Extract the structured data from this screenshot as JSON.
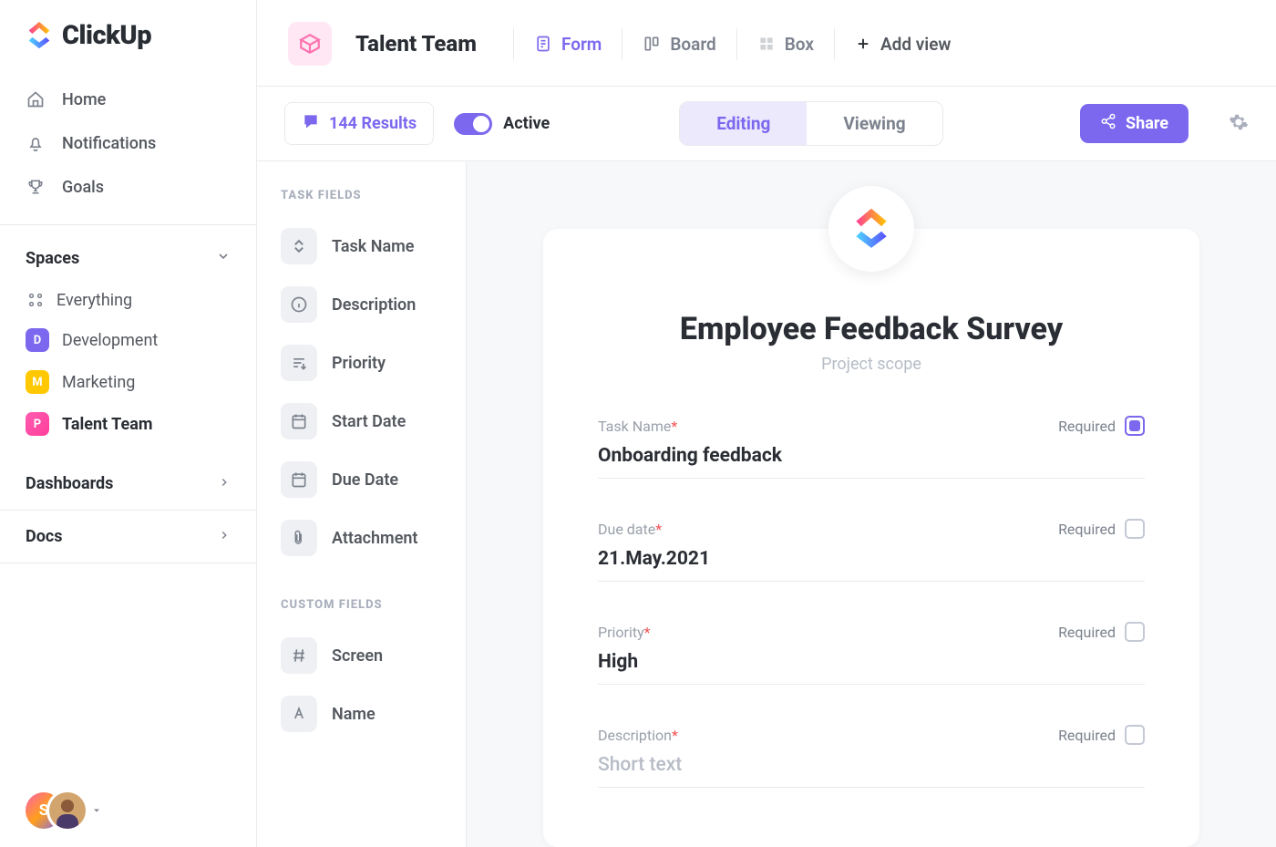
{
  "brand": {
    "name": "ClickUp"
  },
  "sidebar": {
    "nav": [
      {
        "label": "Home"
      },
      {
        "label": "Notifications"
      },
      {
        "label": "Goals"
      }
    ],
    "spaces_heading": "Spaces",
    "everything": "Everything",
    "spaces": [
      {
        "letter": "D",
        "label": "Development"
      },
      {
        "letter": "M",
        "label": "Marketing"
      },
      {
        "letter": "P",
        "label": "Talent Team"
      }
    ],
    "dashboards": "Dashboards",
    "docs": "Docs",
    "user_initial": "S"
  },
  "topbar": {
    "space_title": "Talent Team",
    "tabs": {
      "form": "Form",
      "board": "Board",
      "box": "Box",
      "add": "Add view"
    }
  },
  "toolbar": {
    "results": "144 Results",
    "active": "Active",
    "editing": "Editing",
    "viewing": "Viewing",
    "share": "Share"
  },
  "fields_panel": {
    "task_heading": "TASK FIELDS",
    "task_fields": [
      "Task Name",
      "Description",
      "Priority",
      "Start Date",
      "Due Date",
      "Attachment"
    ],
    "custom_heading": "CUSTOM FIELDS",
    "custom_fields": [
      "Screen",
      "Name"
    ]
  },
  "form": {
    "title": "Employee Feedback Survey",
    "subtitle": "Project scope",
    "required_label": "Required",
    "fields": [
      {
        "label": "Task Name",
        "value": "Onboarding feedback",
        "required_checked": true
      },
      {
        "label": "Due date",
        "value": "21.May.2021",
        "required_checked": false
      },
      {
        "label": "Priority",
        "value": "High",
        "required_checked": false
      },
      {
        "label": "Description",
        "value": "Short text",
        "placeholder": true,
        "required_checked": false
      }
    ]
  }
}
